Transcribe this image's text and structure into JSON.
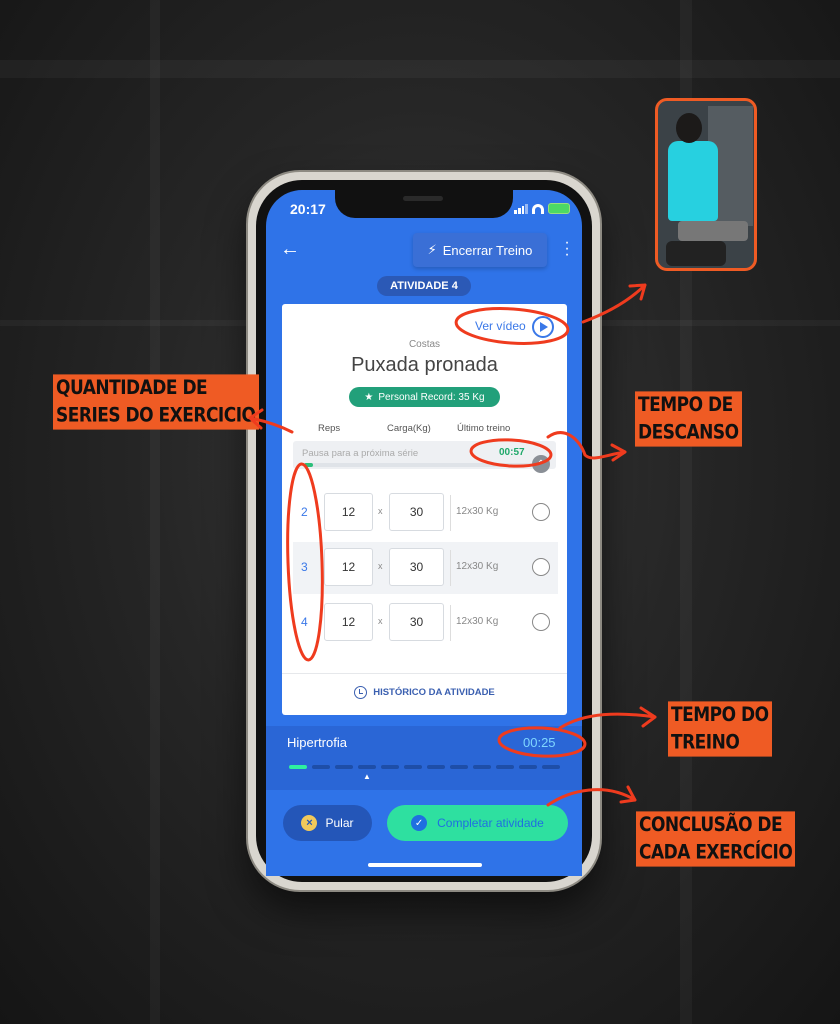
{
  "status_bar": {
    "time": "20:17"
  },
  "top_bar": {
    "end_workout_label": "Encerrar Treino"
  },
  "activity_badge": "ATIVIDADE 4",
  "exercise": {
    "video_link": "Ver vídeo",
    "category": "Costas",
    "title": "Puxada pronada",
    "personal_record": "Personal Record: 35 Kg"
  },
  "columns": {
    "reps": "Reps",
    "load": "Carga(Kg)",
    "last": "Último treino"
  },
  "rest": {
    "label": "Pausa para a próxima série",
    "time": "00:57",
    "progress": 0.04
  },
  "sets": [
    {
      "number": "2",
      "reps": "12",
      "x": "x",
      "load": "30",
      "last": "12x30 Kg"
    },
    {
      "number": "3",
      "reps": "12",
      "x": "x",
      "load": "30",
      "last": "12x30 Kg"
    },
    {
      "number": "4",
      "reps": "12",
      "x": "x",
      "load": "30",
      "last": "12x30 Kg"
    }
  ],
  "history_link": "HISTÓRICO DA ATIVIDADE",
  "program": {
    "name": "Hipertrofia",
    "timer": "00:25",
    "steps_total": 12,
    "steps_done": 1
  },
  "actions": {
    "skip": "Pular",
    "complete": "Completar atividade"
  },
  "annotations": {
    "sets_count": [
      "QUANTIDADE DE",
      "SERIES DO EXERCICIO"
    ],
    "rest_time": [
      "TEMPO DE",
      "DESCANSO"
    ],
    "workout_time": [
      "TEMPO DO",
      "TREINO"
    ],
    "completion": [
      "CONCLUSÃO DE",
      "CADA EXERCÍCIO"
    ]
  },
  "colors": {
    "accent": "#ef5b24",
    "app_blue": "#2f73e8",
    "success": "#2ee0a0"
  }
}
